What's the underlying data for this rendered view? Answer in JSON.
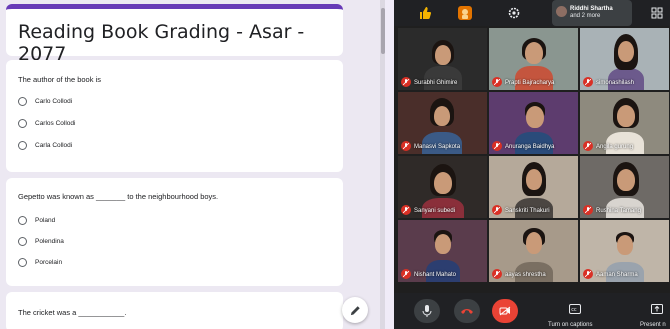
{
  "form": {
    "title": "Reading Book Grading - Asar - 2077",
    "questions": [
      {
        "text": "The author of the book is",
        "options": [
          "Carlo Collodi",
          "Carlos Collodi",
          "Carla Collodi"
        ]
      },
      {
        "text": "Gepetto was known as _______ to the neighbourhood boys.",
        "options": [
          "Poland",
          "Polendina",
          "Porcelain"
        ]
      },
      {
        "text": "The cricket was a ___________.",
        "options": []
      }
    ],
    "accent_color": "#673ab7"
  },
  "meet": {
    "presenter": {
      "name": "Riddhi Shartha",
      "more": "and 2 more"
    },
    "participants": [
      {
        "name": "Surabhi Ghimire"
      },
      {
        "name": "Prapti Bajracharya"
      },
      {
        "name": "simonashilash"
      },
      {
        "name": "Manasvi Sapkota"
      },
      {
        "name": "Anuranga Baidhya"
      },
      {
        "name": "Angila gurung"
      },
      {
        "name": "Sanyani subedi"
      },
      {
        "name": "Sanskriti Thakuri"
      },
      {
        "name": "Rushina Tamang"
      },
      {
        "name": "Nishant Mahato"
      },
      {
        "name": "aayas shrestha"
      },
      {
        "name": "Aaman Sharma"
      }
    ],
    "controls": {
      "captions_label": "Turn on captions",
      "present_label": "Present n"
    },
    "icons": [
      "thumbs-up-icon",
      "raise-hand-icon",
      "settings-icon",
      "grid-layout-icon",
      "mic-icon",
      "end-call-icon",
      "camera-off-icon",
      "captions-icon",
      "present-icon"
    ],
    "colors": {
      "mic_muted": "#d93025",
      "end_call": "#ea4335"
    }
  }
}
